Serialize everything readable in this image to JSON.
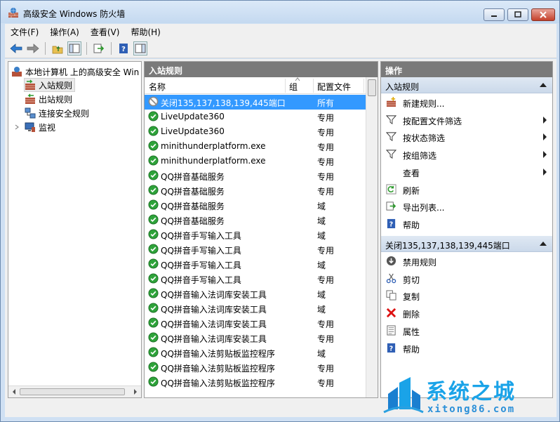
{
  "window": {
    "title": "高级安全 Windows 防火墙"
  },
  "menubar": {
    "items": [
      "文件(F)",
      "操作(A)",
      "查看(V)",
      "帮助(H)"
    ]
  },
  "tree": {
    "root": "本地计算机 上的高级安全 Win",
    "items": [
      "入站规则",
      "出站规则",
      "连接安全规则",
      "监视"
    ]
  },
  "list": {
    "header": "入站规则",
    "columns": {
      "name": "名称",
      "group": "组",
      "profile": "配置文件"
    },
    "rows": [
      {
        "name": "关闭135,137,138,139,445端口",
        "profile": "所有",
        "status": "blocked"
      },
      {
        "name": "LiveUpdate360",
        "profile": "专用",
        "status": "allowed"
      },
      {
        "name": "LiveUpdate360",
        "profile": "专用",
        "status": "allowed"
      },
      {
        "name": "minithunderplatform.exe",
        "profile": "专用",
        "status": "allowed"
      },
      {
        "name": "minithunderplatform.exe",
        "profile": "专用",
        "status": "allowed"
      },
      {
        "name": "QQ拼音基础服务",
        "profile": "专用",
        "status": "allowed"
      },
      {
        "name": "QQ拼音基础服务",
        "profile": "专用",
        "status": "allowed"
      },
      {
        "name": "QQ拼音基础服务",
        "profile": "域",
        "status": "allowed"
      },
      {
        "name": "QQ拼音基础服务",
        "profile": "域",
        "status": "allowed"
      },
      {
        "name": "QQ拼音手写输入工具",
        "profile": "域",
        "status": "allowed"
      },
      {
        "name": "QQ拼音手写输入工具",
        "profile": "专用",
        "status": "allowed"
      },
      {
        "name": "QQ拼音手写输入工具",
        "profile": "域",
        "status": "allowed"
      },
      {
        "name": "QQ拼音手写输入工具",
        "profile": "专用",
        "status": "allowed"
      },
      {
        "name": "QQ拼音输入法词库安装工具",
        "profile": "域",
        "status": "allowed"
      },
      {
        "name": "QQ拼音输入法词库安装工具",
        "profile": "域",
        "status": "allowed"
      },
      {
        "name": "QQ拼音输入法词库安装工具",
        "profile": "专用",
        "status": "allowed"
      },
      {
        "name": "QQ拼音输入法词库安装工具",
        "profile": "专用",
        "status": "allowed"
      },
      {
        "name": "QQ拼音输入法剪贴板监控程序",
        "profile": "域",
        "status": "allowed"
      },
      {
        "name": "QQ拼音输入法剪贴板监控程序",
        "profile": "专用",
        "status": "allowed"
      },
      {
        "name": "QQ拼音输入法剪贴板监控程序",
        "profile": "专用",
        "status": "allowed"
      }
    ]
  },
  "actions": {
    "header": "操作",
    "section1": {
      "title": "入站规则",
      "items": [
        {
          "label": "新建规则...",
          "icon": "new-rule-icon",
          "submenu": false
        },
        {
          "label": "按配置文件筛选",
          "icon": "filter-icon",
          "submenu": true
        },
        {
          "label": "按状态筛选",
          "icon": "filter-icon",
          "submenu": true
        },
        {
          "label": "按组筛选",
          "icon": "filter-icon",
          "submenu": true
        },
        {
          "label": "查看",
          "icon": "",
          "submenu": true
        },
        {
          "label": "刷新",
          "icon": "refresh-icon",
          "submenu": false
        },
        {
          "label": "导出列表...",
          "icon": "export-icon",
          "submenu": false
        },
        {
          "label": "帮助",
          "icon": "help-icon",
          "submenu": false
        }
      ]
    },
    "section2": {
      "title": "关闭135,137,138,139,445端口",
      "items": [
        {
          "label": "禁用规则",
          "icon": "disable-icon"
        },
        {
          "label": "剪切",
          "icon": "cut-icon"
        },
        {
          "label": "复制",
          "icon": "copy-icon"
        },
        {
          "label": "删除",
          "icon": "delete-icon"
        },
        {
          "label": "属性",
          "icon": "properties-icon"
        },
        {
          "label": "帮助",
          "icon": "help-icon"
        }
      ]
    }
  },
  "watermark": {
    "brand": "系统之城",
    "url": "xitong86.com"
  },
  "colors": {
    "selection": "#3399ff",
    "allowed": "#2ea33a",
    "header_bg": "#7a7a7a"
  }
}
